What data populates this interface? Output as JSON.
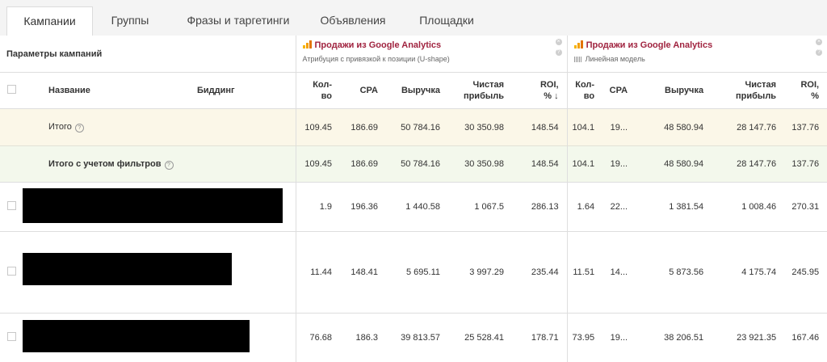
{
  "tabs": [
    {
      "label": "Кампании",
      "active": true
    },
    {
      "label": "Группы",
      "active": false
    },
    {
      "label": "Фразы и таргетинги",
      "active": false
    },
    {
      "label": "Объявления",
      "active": false
    },
    {
      "label": "Площадки",
      "active": false
    }
  ],
  "params_title": "Параметры кампаний",
  "attribution_1": {
    "title": "Продажи из Google Analytics",
    "subtitle": "Атрибуция с привязкой к позиции (U-shape)"
  },
  "attribution_2": {
    "title": "Продажи из Google Analytics",
    "subtitle": "Линейная модель"
  },
  "columns": {
    "name": "Название",
    "bidding": "Биддинг",
    "qty_1": "Кол-",
    "qty_2": "во",
    "cpa": "CPA",
    "revenue": "Выручка",
    "profit_1": "Чистая",
    "profit_2": "прибыль",
    "roi_1": "ROI,",
    "roi_2": "%",
    "sort_arrow": "↓"
  },
  "totals": {
    "label": "Итого",
    "m1": [
      "109.45",
      "186.69",
      "50 784.16",
      "30 350.98",
      "148.54"
    ],
    "m2": [
      "104.1",
      "19...",
      "48 580.94",
      "28 147.76",
      "137.76"
    ]
  },
  "filtered_totals": {
    "label": "Итого с учетом фильтров",
    "m1": [
      "109.45",
      "186.69",
      "50 784.16",
      "30 350.98",
      "148.54"
    ],
    "m2": [
      "104.1",
      "19...",
      "48 580.94",
      "28 147.76",
      "137.76"
    ]
  },
  "campaigns": [
    {
      "m1": [
        "1.9",
        "196.36",
        "1 440.58",
        "1 067.5",
        "286.13"
      ],
      "m2": [
        "1.64",
        "22...",
        "1 381.54",
        "1 008.46",
        "270.31"
      ]
    },
    {
      "m1": [
        "11.44",
        "148.41",
        "5 695.11",
        "3 997.29",
        "235.44"
      ],
      "m2": [
        "11.51",
        "14...",
        "5 873.56",
        "4 175.74",
        "245.95"
      ]
    },
    {
      "m1": [
        "76.68",
        "186.3",
        "39 813.57",
        "25 528.41",
        "178.71"
      ],
      "m2": [
        "73.95",
        "19...",
        "38 206.51",
        "23 921.35",
        "167.46"
      ]
    }
  ],
  "colors": {
    "accent": "#a0233f",
    "total_row_bg": "#fbf7e8",
    "filter_row_bg": "#f3f8ec",
    "redaction": "#000000"
  },
  "icons": {
    "ga": "google-analytics-bars-icon",
    "linear": "linear-model-icon",
    "help": "help-circle-icon",
    "sort": "sort-down-arrow-icon"
  }
}
